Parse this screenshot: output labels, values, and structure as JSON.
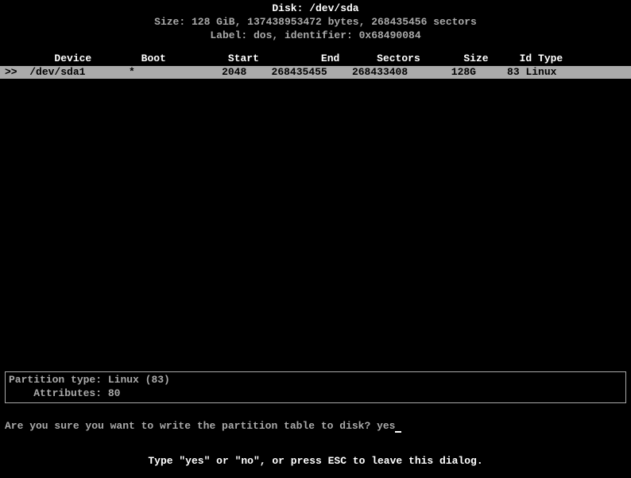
{
  "header": {
    "disk_label": "Disk: ",
    "disk_path": "/dev/sda",
    "size_line": "Size: 128 GiB, 137438953472 bytes, 268435456 sectors",
    "label_line": "Label: dos, identifier: 0x68490084"
  },
  "table": {
    "headers": {
      "device": "Device",
      "boot": "Boot",
      "start": "Start",
      "end": "End",
      "sectors": "Sectors",
      "size": "Size",
      "id": "Id",
      "type": "Type"
    },
    "row": {
      "cursor": ">>",
      "device": "/dev/sda1",
      "boot": "*",
      "start": "2048",
      "end": "268435455",
      "sectors": "268433408",
      "size": "128G",
      "id": "83",
      "type": "Linux"
    }
  },
  "info": {
    "partition_type_label": "Partition type:",
    "partition_type_value": "Linux (83)",
    "attributes_label": "Attributes:",
    "attributes_value": "80"
  },
  "prompt": {
    "question": "Are you sure you want to write the partition table to disk? ",
    "input": "yes"
  },
  "footer": {
    "hint": "Type \"yes\" or \"no\", or press ESC to leave this dialog."
  }
}
